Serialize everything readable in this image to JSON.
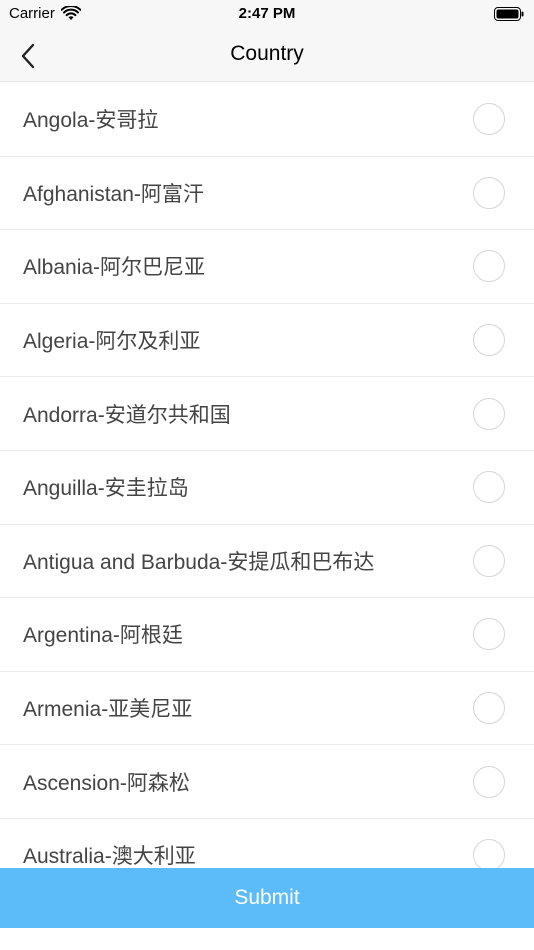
{
  "status_bar": {
    "carrier": "Carrier",
    "time": "2:47 PM",
    "wifi_icon": "wifi-icon",
    "battery_icon": "battery-icon"
  },
  "nav": {
    "title": "Country",
    "back_icon": "chevron-left-icon"
  },
  "countries": [
    {
      "label": "Angola-安哥拉",
      "selected": false
    },
    {
      "label": "Afghanistan-阿富汗",
      "selected": false
    },
    {
      "label": "Albania-阿尔巴尼亚",
      "selected": false
    },
    {
      "label": "Algeria-阿尔及利亚",
      "selected": false
    },
    {
      "label": "Andorra-安道尔共和国",
      "selected": false
    },
    {
      "label": "Anguilla-安圭拉岛",
      "selected": false
    },
    {
      "label": "Antigua and Barbuda-安提瓜和巴布达",
      "selected": false
    },
    {
      "label": "Argentina-阿根廷",
      "selected": false
    },
    {
      "label": "Armenia-亚美尼亚",
      "selected": false
    },
    {
      "label": "Ascension-阿森松",
      "selected": false
    },
    {
      "label": "Australia-澳大利亚",
      "selected": false
    }
  ],
  "submit_label": "Submit",
  "colors": {
    "accent": "#5bbcf9",
    "nav_background": "#f7f7f7",
    "radio_border": "#d6d6d6"
  }
}
